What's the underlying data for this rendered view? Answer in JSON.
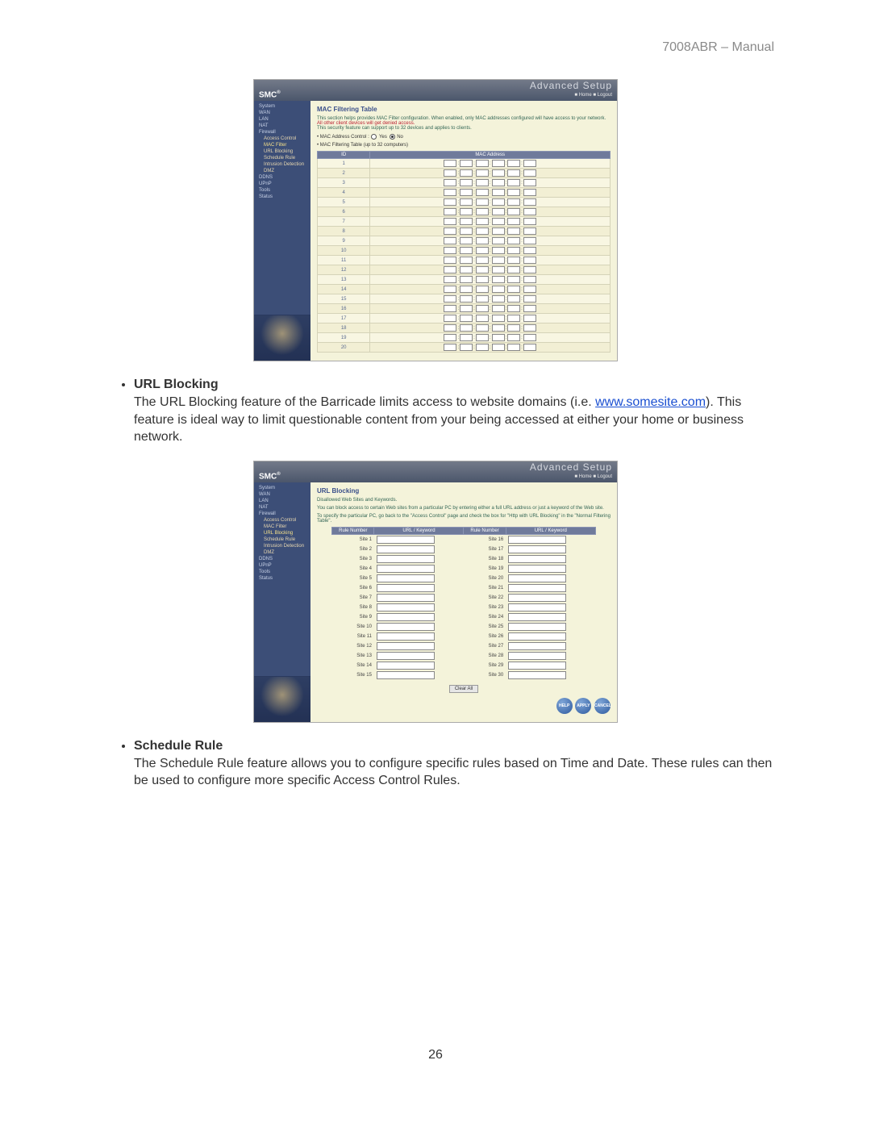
{
  "doc": {
    "header": "7008ABR – Manual",
    "page_number": "26",
    "link_text": "www.somesite.com"
  },
  "items": [
    {
      "title": "URL Blocking",
      "body_pre": "The URL Blocking feature of the Barricade limits access to website domains (i.e. ",
      "body_post": "). This feature is ideal way to limit questionable content from your being accessed at either your home or business network."
    },
    {
      "title": "Schedule Rule",
      "body": "The Schedule Rule feature allows you to configure specific rules based on Time and Date. These rules can then be used to configure more specific Access Control Rules."
    }
  ],
  "shot_common": {
    "logo": "SMC",
    "adv_big": "Advanced Setup",
    "adv_small": "■ Home  ■ Logout"
  },
  "shot1": {
    "title": "MAC Filtering Table",
    "desc_line1": "This section helps provides MAC Filter configuration. When enabled, only MAC addresses configured will have access to your network.",
    "desc_warn": " All other client devices will get denied access.",
    "desc_line2": "This security feature can support up to 32 devices and applies to clients.",
    "opt_label": "MAC Address Control : ",
    "opt_yes": "Yes",
    "opt_no": "No",
    "sub_label": "MAC Filtering Table (up to 32 computers)",
    "th_id": "ID",
    "th_mac": "MAC Address",
    "rows": [
      "1",
      "2",
      "3",
      "4",
      "5",
      "6",
      "7",
      "8",
      "9",
      "10",
      "11",
      "12",
      "13",
      "14",
      "15",
      "16",
      "17",
      "18",
      "19",
      "20"
    ],
    "nav": [
      "System",
      "WAN",
      "LAN",
      "NAT",
      "Firewall",
      "Access Control",
      "MAC Filter",
      "URL Blocking",
      "Schedule Rule",
      "Intrusion Detection",
      "DMZ",
      "DDNS",
      "UPnP",
      "Tools",
      "Status"
    ]
  },
  "shot2": {
    "title": "URL Blocking",
    "sub": "Disallowed Web Sites and Keywords.",
    "desc1": "You can block access to certain Web sites from a particular PC by entering either a full URL address or just a keyword of the Web site.",
    "desc2": "To specify the particular PC, go back to the \"Access Control\" page and check the box for \"Http with URL Blocking\" in the \"Normal Filtering Table\".",
    "th_rule": "Rule Number",
    "th_key": "URL / Keyword",
    "left_rows": [
      "Site  1",
      "Site  2",
      "Site  3",
      "Site  4",
      "Site  5",
      "Site  6",
      "Site  7",
      "Site  8",
      "Site  9",
      "Site  10",
      "Site  11",
      "Site  12",
      "Site  13",
      "Site  14",
      "Site  15"
    ],
    "right_rows": [
      "Site  16",
      "Site  17",
      "Site  18",
      "Site  19",
      "Site  20",
      "Site  21",
      "Site  22",
      "Site  23",
      "Site  24",
      "Site  25",
      "Site  26",
      "Site  27",
      "Site  28",
      "Site  29",
      "Site  30"
    ],
    "clear_btn": "Clear All",
    "round": [
      "HELP",
      "APPLY",
      "CANCEL"
    ],
    "nav": [
      "System",
      "WAN",
      "LAN",
      "NAT",
      "Firewall",
      "Access Control",
      "MAC Filter",
      "URL Blocking",
      "Schedule Rule",
      "Intrusion Detection",
      "DMZ",
      "DDNS",
      "UPnP",
      "Tools",
      "Status"
    ]
  }
}
